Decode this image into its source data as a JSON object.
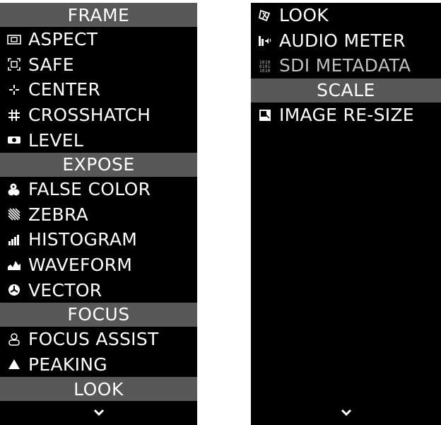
{
  "left_panel": {
    "frame_header": "FRAME",
    "frame_items": [
      {
        "label": "ASPECT",
        "icon": "aspect-icon"
      },
      {
        "label": "SAFE",
        "icon": "safe-icon"
      },
      {
        "label": "CENTER",
        "icon": "center-icon"
      },
      {
        "label": "CROSSHATCH",
        "icon": "crosshatch-icon"
      },
      {
        "label": "LEVEL",
        "icon": "level-icon"
      }
    ],
    "expose_header": "EXPOSE",
    "expose_items": [
      {
        "label": "FALSE COLOR",
        "icon": "false-color-icon"
      },
      {
        "label": "ZEBRA",
        "icon": "zebra-icon"
      },
      {
        "label": "HISTOGRAM",
        "icon": "histogram-icon"
      },
      {
        "label": "WAVEFORM",
        "icon": "waveform-icon"
      },
      {
        "label": "VECTOR",
        "icon": "vector-icon"
      }
    ],
    "focus_header": "FOCUS",
    "focus_items": [
      {
        "label": "FOCUS ASSIST",
        "icon": "focus-assist-icon"
      },
      {
        "label": "PEAKING",
        "icon": "peaking-icon"
      }
    ],
    "look_header": "LOOK",
    "more_icon": "chevron-down-icon"
  },
  "right_panel": {
    "look_items": [
      {
        "label": "LOOK",
        "icon": "look-icon"
      },
      {
        "label": "AUDIO METER",
        "icon": "audio-meter-icon"
      },
      {
        "label": "SDI METADATA",
        "icon": "sdi-metadata-icon"
      }
    ],
    "scale_header": "SCALE",
    "scale_items": [
      {
        "label": "IMAGE RE-SIZE",
        "icon": "image-resize-icon"
      }
    ],
    "more_icon": "chevron-down-icon"
  },
  "colors": {
    "panel_background": "#000000",
    "header_background": "#585858",
    "text": "#ffffff",
    "page_background": "#ffffff"
  }
}
